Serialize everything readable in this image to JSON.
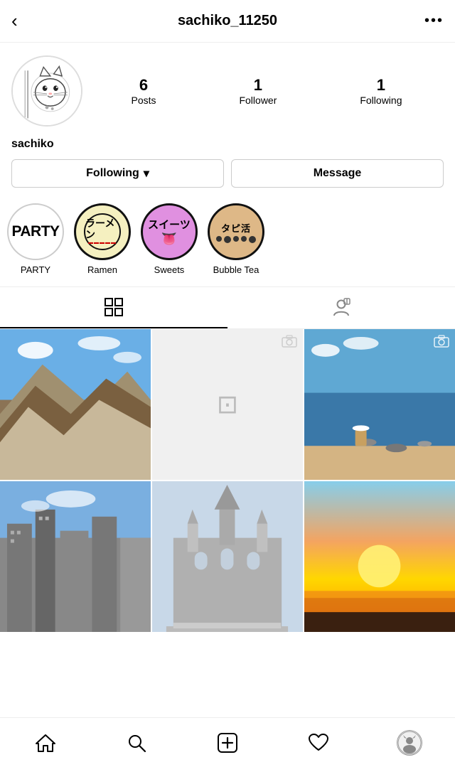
{
  "header": {
    "title": "sachiko_11250",
    "back_label": "‹",
    "more_label": "•••"
  },
  "profile": {
    "username": "sachiko",
    "stats": [
      {
        "number": "6",
        "label": "Posts"
      },
      {
        "number": "1",
        "label": "Follower"
      },
      {
        "number": "1",
        "label": "Following"
      }
    ],
    "following_button": "Following",
    "following_chevron": "▾",
    "message_button": "Message"
  },
  "highlights": [
    {
      "label": "PARTY",
      "type": "party"
    },
    {
      "label": "Ramen",
      "type": "ramen"
    },
    {
      "label": "Sweets",
      "type": "sweets"
    },
    {
      "label": "Bubble Tea",
      "type": "bubble"
    }
  ],
  "tabs": [
    {
      "name": "grid",
      "icon": "⊞",
      "active": true
    },
    {
      "name": "tagged",
      "icon": "👤",
      "active": false
    }
  ],
  "grid": {
    "cells": [
      {
        "type": "mountain"
      },
      {
        "type": "empty"
      },
      {
        "type": "beach"
      },
      {
        "type": "city"
      },
      {
        "type": "cathedral"
      },
      {
        "type": "sunset"
      }
    ]
  },
  "bottom_nav": [
    {
      "name": "home",
      "icon": "home"
    },
    {
      "name": "search",
      "icon": "search"
    },
    {
      "name": "add",
      "icon": "add"
    },
    {
      "name": "heart",
      "icon": "heart"
    },
    {
      "name": "profile",
      "icon": "avatar"
    }
  ]
}
